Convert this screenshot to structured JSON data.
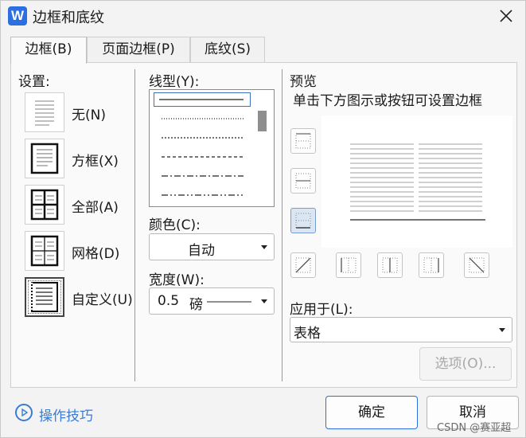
{
  "window": {
    "app_icon_letter": "W",
    "title": "边框和底纹"
  },
  "tabs": [
    {
      "label": "边框(B)",
      "active": true
    },
    {
      "label": "页面边框(P)",
      "active": false
    },
    {
      "label": "底纹(S)",
      "active": false
    }
  ],
  "settings": {
    "heading": "设置:",
    "items": [
      {
        "label": "无(N)",
        "icon": "border-none-icon"
      },
      {
        "label": "方框(X)",
        "icon": "border-box-icon"
      },
      {
        "label": "全部(A)",
        "icon": "border-all-icon"
      },
      {
        "label": "网格(D)",
        "icon": "border-grid-icon"
      },
      {
        "label": "自定义(U)",
        "icon": "border-custom-icon",
        "selected": true
      }
    ]
  },
  "line_style": {
    "heading": "线型(Y):",
    "styles": [
      "solid",
      "dotted",
      "dashed-fine",
      "dashed",
      "dash-dot",
      "dash-dot-dot"
    ]
  },
  "color": {
    "heading": "颜色(C):",
    "value": "自动"
  },
  "width": {
    "heading": "宽度(W):",
    "value": "0.5",
    "unit": "磅"
  },
  "preview": {
    "heading": "预览",
    "hint": "单击下方图示或按钮可设置边框"
  },
  "apply_to": {
    "heading": "应用于(L):",
    "value": "表格"
  },
  "options_button": "选项(O)...",
  "footer": {
    "tips_label": "操作技巧",
    "ok_label": "确定",
    "cancel_label": "取消",
    "watermark": "CSDN @赛亚超"
  },
  "colors": {
    "accent": "#2b6fe0",
    "link": "#3a7bd5"
  }
}
